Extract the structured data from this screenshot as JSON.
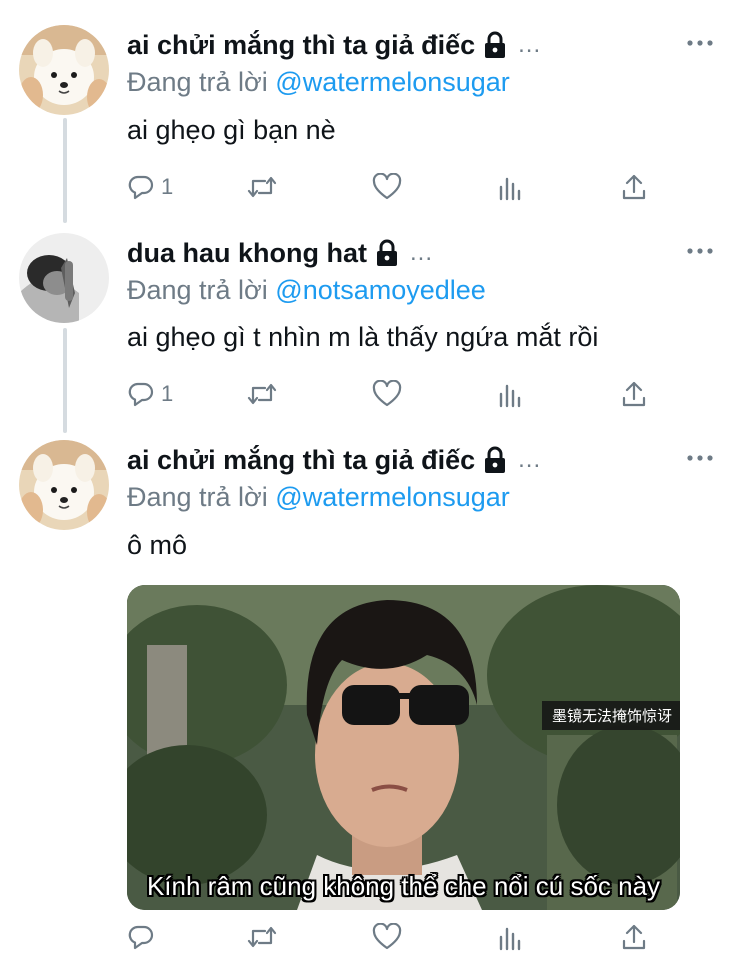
{
  "tweets": [
    {
      "display_name": "ai chửi mắng thì ta giả điếc",
      "ellipsis": "...",
      "reply_prefix": "Đang trả lời",
      "reply_to": "@watermelonsugar",
      "text": "ai ghẹo gì bạn nè",
      "reply_count": "1",
      "avatar": "white-dog-avatar"
    },
    {
      "display_name": "dua hau khong hat",
      "ellipsis": "...",
      "reply_prefix": "Đang trả lời",
      "reply_to": "@notsamoyedlee",
      "text": "ai ghẹo gì t nhìn m là thấy ngứa mắt rồi",
      "reply_count": "1",
      "avatar": "person-grayscale-avatar"
    },
    {
      "display_name": "ai chửi mắng thì ta giả điếc",
      "ellipsis": "...",
      "reply_prefix": "Đang trả lời",
      "reply_to": "@watermelonsugar",
      "text": "ô mô",
      "reply_count": "",
      "avatar": "white-dog-avatar",
      "media": {
        "caption": "Kính râm cũng không thể che nổi cú sốc này",
        "tag": "墨镜无法掩饰惊讶"
      }
    }
  ],
  "icons": {
    "reply": "reply-icon",
    "retweet": "retweet-icon",
    "like": "like-icon",
    "analytics": "analytics-icon",
    "share": "share-icon",
    "more": "more-icon",
    "lock": "lock-icon"
  },
  "colors": {
    "text": "#0f1419",
    "secondary": "#6e7b86",
    "mention": "#1d9bf0",
    "thread_line": "#d5dbe0"
  }
}
